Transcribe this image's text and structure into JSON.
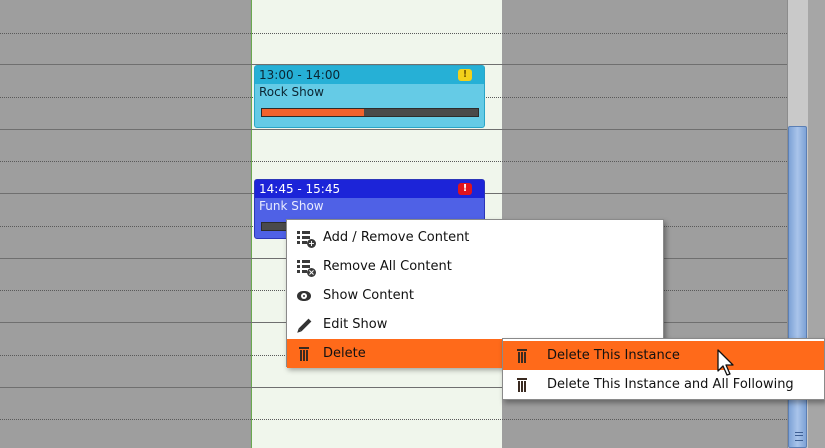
{
  "events": [
    {
      "time": "13:00 - 14:00",
      "title": "Rock Show",
      "badge": "!",
      "progress": 0.47
    },
    {
      "time": "14:45 - 15:45",
      "title": "Funk Show",
      "badge": "!"
    }
  ],
  "context_menu": {
    "items": [
      {
        "label": "Add / Remove Content",
        "icon": "add-content-icon"
      },
      {
        "label": "Remove All Content",
        "icon": "remove-content-icon"
      },
      {
        "label": "Show Content",
        "icon": "eye-icon"
      },
      {
        "label": "Edit Show",
        "icon": "pencil-icon"
      },
      {
        "label": "Delete",
        "icon": "trash-icon",
        "active": true
      }
    ]
  },
  "delete_submenu": {
    "items": [
      {
        "label": "Delete This Instance",
        "icon": "trash-icon",
        "active": true
      },
      {
        "label": "Delete This Instance and All Following",
        "icon": "trash-icon"
      }
    ]
  },
  "colors": {
    "menu_highlight": "#ff6a1a",
    "rock_show": "#65cbe6",
    "funk_show": "#4f61e6",
    "today_column": "#f0f6ec"
  }
}
